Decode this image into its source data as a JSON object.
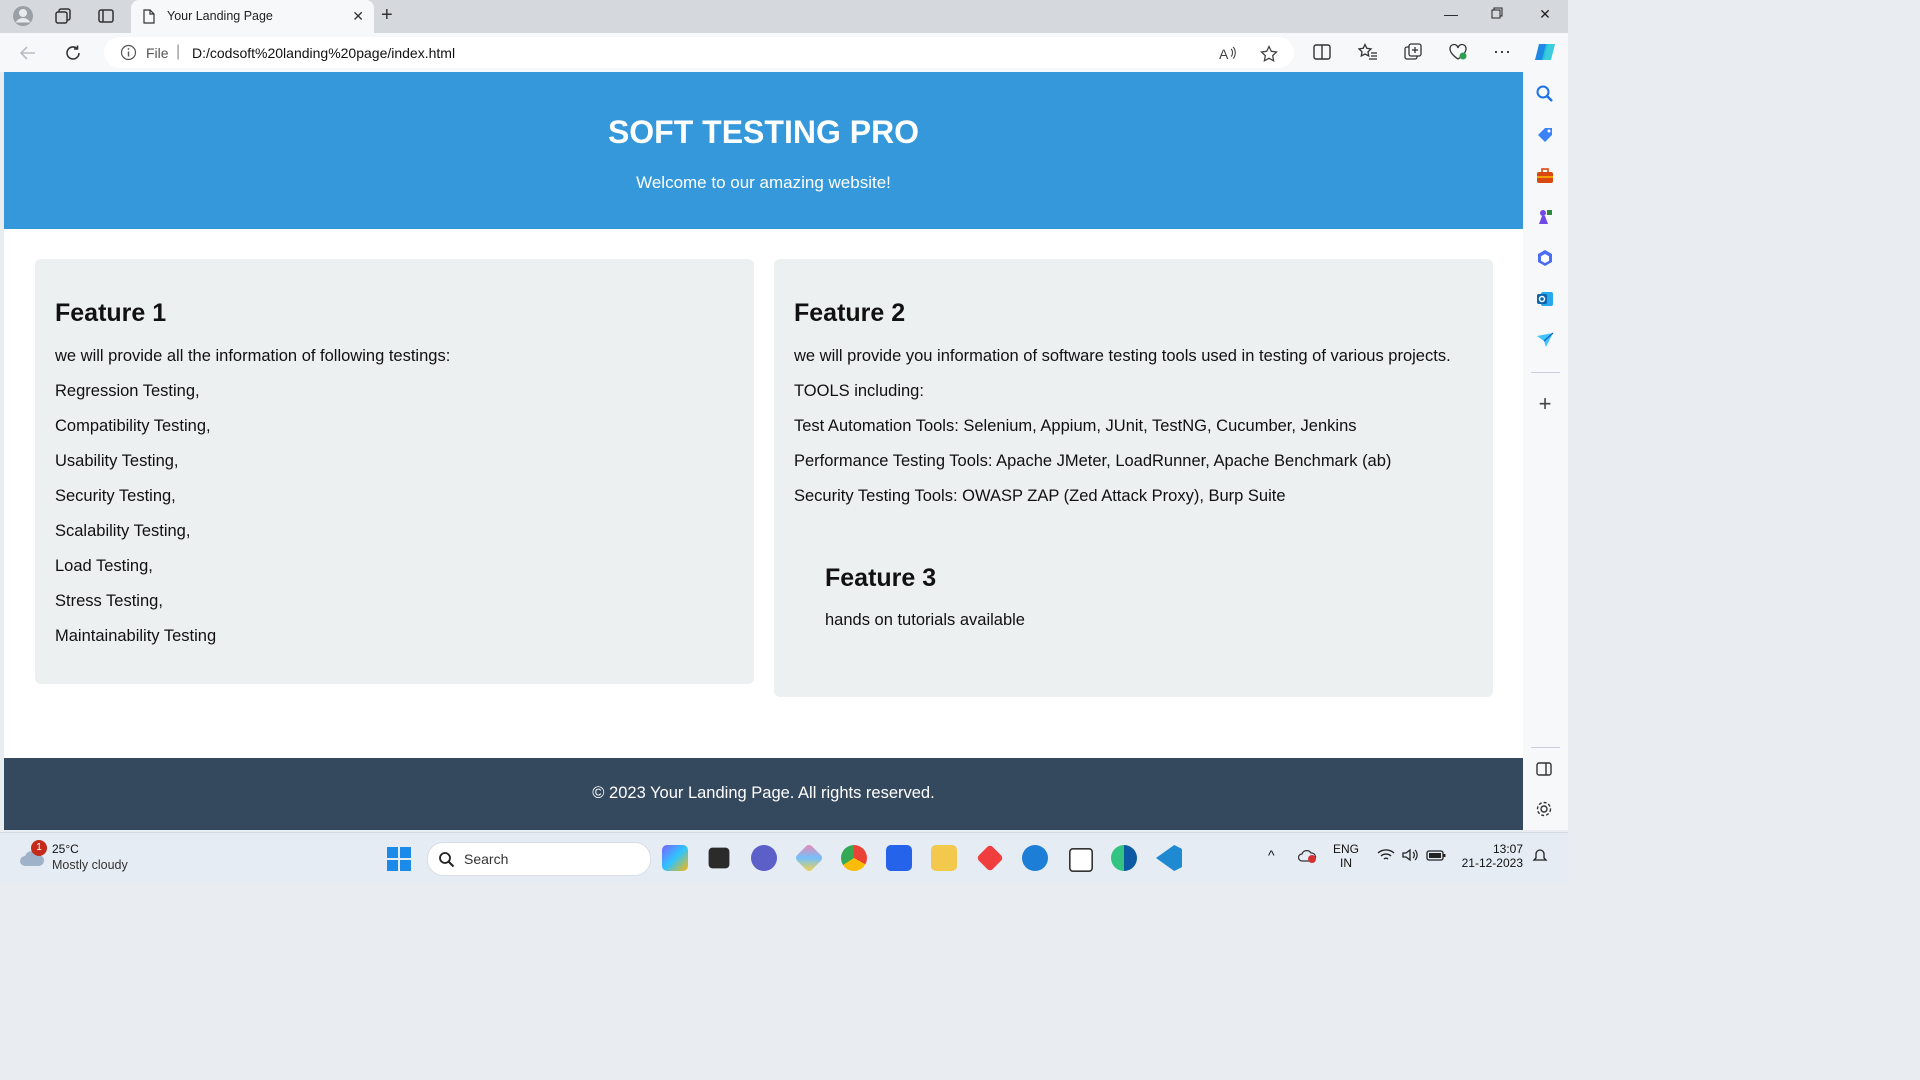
{
  "browser": {
    "tab_title": "Your Landing Page",
    "address_label": "File",
    "url": "D:/codsoft%20landing%20page/index.html"
  },
  "page": {
    "hero": {
      "title": "SOFT TESTING PRO",
      "subtitle": "Welcome to our amazing website!"
    },
    "feature1": {
      "heading": "Feature 1",
      "intro": "we will provide all the information of following testings:",
      "items": [
        "Regression Testing,",
        "Compatibility Testing,",
        "Usability Testing,",
        "Security Testing,",
        "Scalability Testing,",
        "Load Testing,",
        "Stress Testing,",
        "Maintainability Testing"
      ]
    },
    "feature2": {
      "heading": "Feature 2",
      "lines": [
        "we will provide you information of software testing tools used in testing of various projects.",
        "TOOLS including:",
        "Test Automation Tools: Selenium, Appium, JUnit, TestNG, Cucumber, Jenkins",
        "Performance Testing Tools: Apache JMeter, LoadRunner, Apache Benchmark (ab)",
        "Security Testing Tools: OWASP ZAP (Zed Attack Proxy), Burp Suite"
      ]
    },
    "feature3": {
      "heading": "Feature 3",
      "text": "hands on tutorials available"
    },
    "footer": "© 2023 Your Landing Page. All rights reserved."
  },
  "taskbar": {
    "weather_badge": "1",
    "temperature": "25°C",
    "weather": "Mostly cloudy",
    "search_label": "Search",
    "language": "ENG",
    "region": "IN",
    "time": "13:07",
    "date": "21-12-2023"
  },
  "colors": {
    "hero_bg": "#3498db",
    "card_bg": "#ecf0f1",
    "footer_bg": "#34495e"
  }
}
